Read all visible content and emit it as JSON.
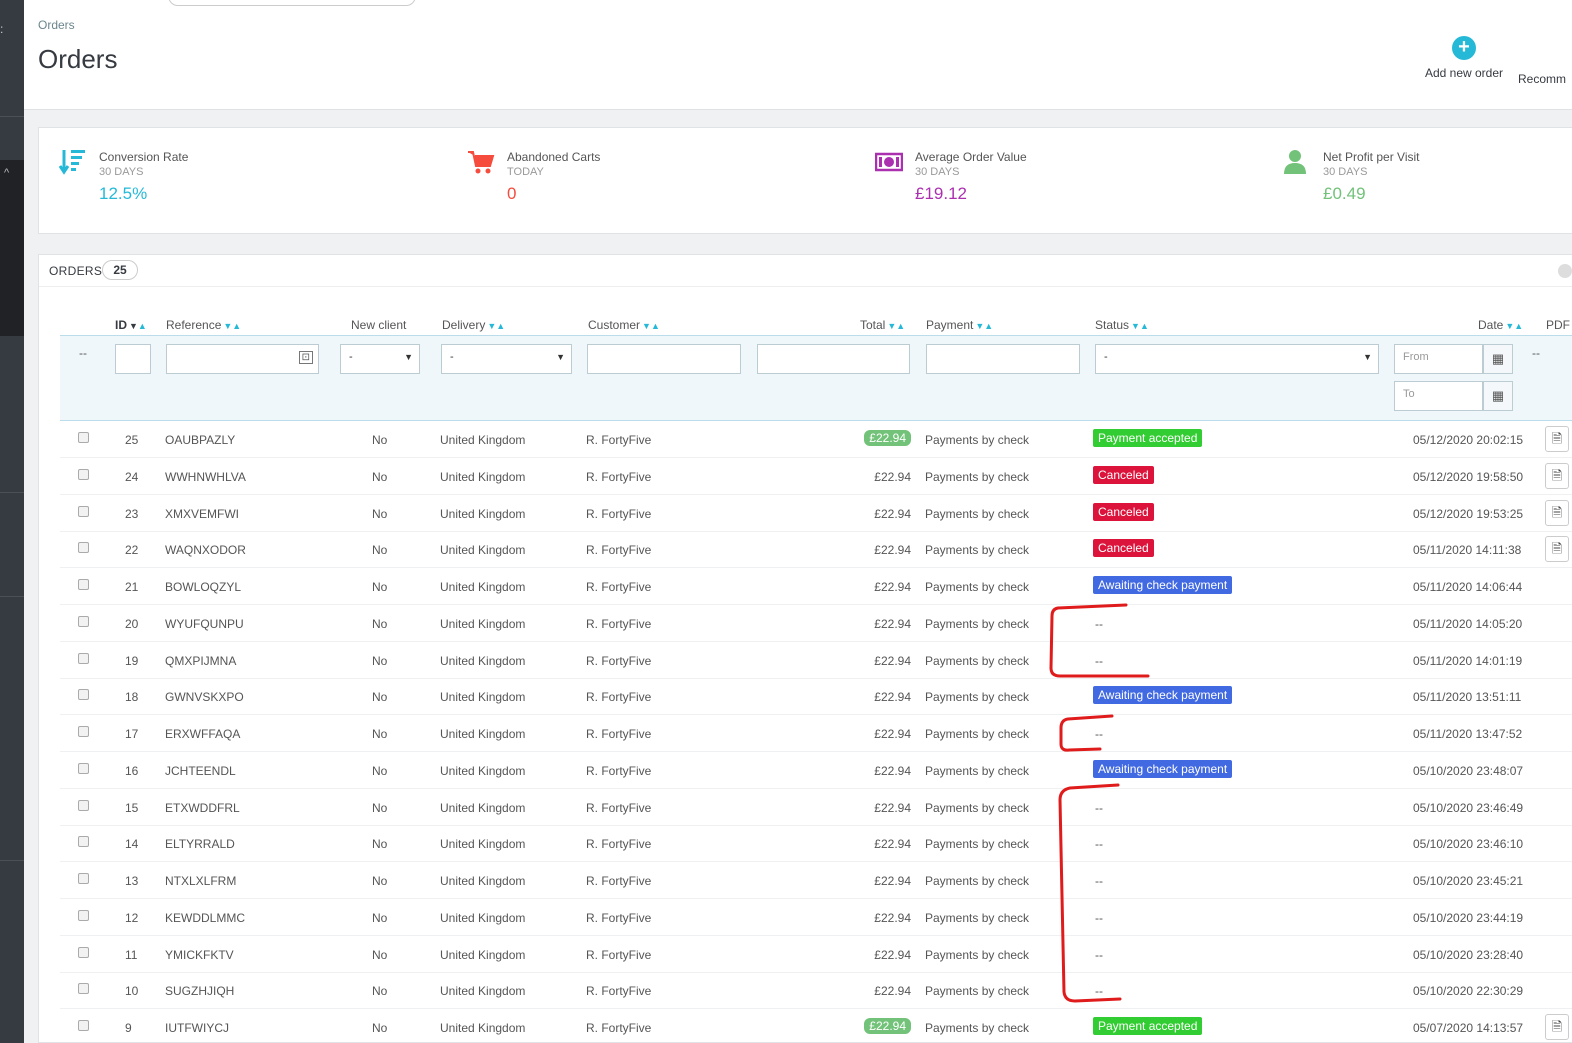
{
  "header": {
    "breadcrumb": "Orders",
    "title": "Orders",
    "add_new_order": "Add new order",
    "recommended": "Recomm"
  },
  "kpis": [
    {
      "title": "Conversion Rate",
      "period": "30 DAYS",
      "value": "12.5%",
      "color": "#25b9d7",
      "icon": "sort-amount-icon"
    },
    {
      "title": "Abandoned Carts",
      "period": "TODAY",
      "value": "0",
      "color": "#f54c3e",
      "icon": "shopping-cart-icon"
    },
    {
      "title": "Average Order Value",
      "period": "30 DAYS",
      "value": "£19.12",
      "color": "#ab30b0",
      "icon": "money-icon"
    },
    {
      "title": "Net Profit per Visit",
      "period": "30 DAYS",
      "value": "£0.49",
      "color": "#72c279",
      "icon": "user-icon"
    }
  ],
  "orders_panel": {
    "title": "ORDERS",
    "count": "25",
    "columns": {
      "id": "ID",
      "reference": "Reference",
      "new_client": "New client",
      "delivery": "Delivery",
      "customer": "Customer",
      "total": "Total",
      "payment": "Payment",
      "status": "Status",
      "date": "Date",
      "pdf": "PDF"
    },
    "filters": {
      "bulk": "--",
      "new_client_select": "-",
      "delivery_select": "-",
      "status_select": "-",
      "date_from": "From",
      "date_to": "To",
      "pdf": "--"
    },
    "rows": [
      {
        "id": "25",
        "reference": "OAUBPAZLY",
        "new_client": "No",
        "delivery": "United Kingdom",
        "customer": "R. FortyFive",
        "total": "£22.94",
        "total_highlight": true,
        "payment": "Payments by check",
        "status": "Payment accepted",
        "status_color": "#32cd32",
        "date": "05/12/2020 20:02:15",
        "pdf": true
      },
      {
        "id": "24",
        "reference": "WWHNWHLVA",
        "new_client": "No",
        "delivery": "United Kingdom",
        "customer": "R. FortyFive",
        "total": "£22.94",
        "total_highlight": false,
        "payment": "Payments by check",
        "status": "Canceled",
        "status_color": "#dc143c",
        "date": "05/12/2020 19:58:50",
        "pdf": true
      },
      {
        "id": "23",
        "reference": "XMXVEMFWI",
        "new_client": "No",
        "delivery": "United Kingdom",
        "customer": "R. FortyFive",
        "total": "£22.94",
        "total_highlight": false,
        "payment": "Payments by check",
        "status": "Canceled",
        "status_color": "#dc143c",
        "date": "05/12/2020 19:53:25",
        "pdf": true
      },
      {
        "id": "22",
        "reference": "WAQNXODOR",
        "new_client": "No",
        "delivery": "United Kingdom",
        "customer": "R. FortyFive",
        "total": "£22.94",
        "total_highlight": false,
        "payment": "Payments by check",
        "status": "Canceled",
        "status_color": "#dc143c",
        "date": "05/11/2020 14:11:38",
        "pdf": true
      },
      {
        "id": "21",
        "reference": "BOWLOQZYL",
        "new_client": "No",
        "delivery": "United Kingdom",
        "customer": "R. FortyFive",
        "total": "£22.94",
        "total_highlight": false,
        "payment": "Payments by check",
        "status": "Awaiting check payment",
        "status_color": "#4169e1",
        "date": "05/11/2020 14:06:44",
        "pdf": false
      },
      {
        "id": "20",
        "reference": "WYUFQUNPU",
        "new_client": "No",
        "delivery": "United Kingdom",
        "customer": "R. FortyFive",
        "total": "£22.94",
        "total_highlight": false,
        "payment": "Payments by check",
        "status": "--",
        "status_color": "",
        "date": "05/11/2020 14:05:20",
        "pdf": false
      },
      {
        "id": "19",
        "reference": "QMXPIJMNA",
        "new_client": "No",
        "delivery": "United Kingdom",
        "customer": "R. FortyFive",
        "total": "£22.94",
        "total_highlight": false,
        "payment": "Payments by check",
        "status": "--",
        "status_color": "",
        "date": "05/11/2020 14:01:19",
        "pdf": false
      },
      {
        "id": "18",
        "reference": "GWNVSKXPO",
        "new_client": "No",
        "delivery": "United Kingdom",
        "customer": "R. FortyFive",
        "total": "£22.94",
        "total_highlight": false,
        "payment": "Payments by check",
        "status": "Awaiting check payment",
        "status_color": "#4169e1",
        "date": "05/11/2020 13:51:11",
        "pdf": false
      },
      {
        "id": "17",
        "reference": "ERXWFFAQA",
        "new_client": "No",
        "delivery": "United Kingdom",
        "customer": "R. FortyFive",
        "total": "£22.94",
        "total_highlight": false,
        "payment": "Payments by check",
        "status": "--",
        "status_color": "",
        "date": "05/11/2020 13:47:52",
        "pdf": false
      },
      {
        "id": "16",
        "reference": "JCHTEENDL",
        "new_client": "No",
        "delivery": "United Kingdom",
        "customer": "R. FortyFive",
        "total": "£22.94",
        "total_highlight": false,
        "payment": "Payments by check",
        "status": "Awaiting check payment",
        "status_color": "#4169e1",
        "date": "05/10/2020 23:48:07",
        "pdf": false
      },
      {
        "id": "15",
        "reference": "ETXWDDFRL",
        "new_client": "No",
        "delivery": "United Kingdom",
        "customer": "R. FortyFive",
        "total": "£22.94",
        "total_highlight": false,
        "payment": "Payments by check",
        "status": "--",
        "status_color": "",
        "date": "05/10/2020 23:46:49",
        "pdf": false
      },
      {
        "id": "14",
        "reference": "ELTYRRALD",
        "new_client": "No",
        "delivery": "United Kingdom",
        "customer": "R. FortyFive",
        "total": "£22.94",
        "total_highlight": false,
        "payment": "Payments by check",
        "status": "--",
        "status_color": "",
        "date": "05/10/2020 23:46:10",
        "pdf": false
      },
      {
        "id": "13",
        "reference": "NTXLXLFRM",
        "new_client": "No",
        "delivery": "United Kingdom",
        "customer": "R. FortyFive",
        "total": "£22.94",
        "total_highlight": false,
        "payment": "Payments by check",
        "status": "--",
        "status_color": "",
        "date": "05/10/2020 23:45:21",
        "pdf": false
      },
      {
        "id": "12",
        "reference": "KEWDDLMMC",
        "new_client": "No",
        "delivery": "United Kingdom",
        "customer": "R. FortyFive",
        "total": "£22.94",
        "total_highlight": false,
        "payment": "Payments by check",
        "status": "--",
        "status_color": "",
        "date": "05/10/2020 23:44:19",
        "pdf": false
      },
      {
        "id": "11",
        "reference": "YMICKFKTV",
        "new_client": "No",
        "delivery": "United Kingdom",
        "customer": "R. FortyFive",
        "total": "£22.94",
        "total_highlight": false,
        "payment": "Payments by check",
        "status": "--",
        "status_color": "",
        "date": "05/10/2020 23:28:40",
        "pdf": false
      },
      {
        "id": "10",
        "reference": "SUGZHJIQH",
        "new_client": "No",
        "delivery": "United Kingdom",
        "customer": "R. FortyFive",
        "total": "£22.94",
        "total_highlight": false,
        "payment": "Payments by check",
        "status": "--",
        "status_color": "",
        "date": "05/10/2020 22:30:29",
        "pdf": false
      },
      {
        "id": "9",
        "reference": "IUTFWIYCJ",
        "new_client": "No",
        "delivery": "United Kingdom",
        "customer": "R. FortyFive",
        "total": "£22.94",
        "total_highlight": true,
        "payment": "Payments by check",
        "status": "Payment accepted",
        "status_color": "#32cd32",
        "date": "05/07/2020 14:13:57",
        "pdf": true
      }
    ]
  }
}
